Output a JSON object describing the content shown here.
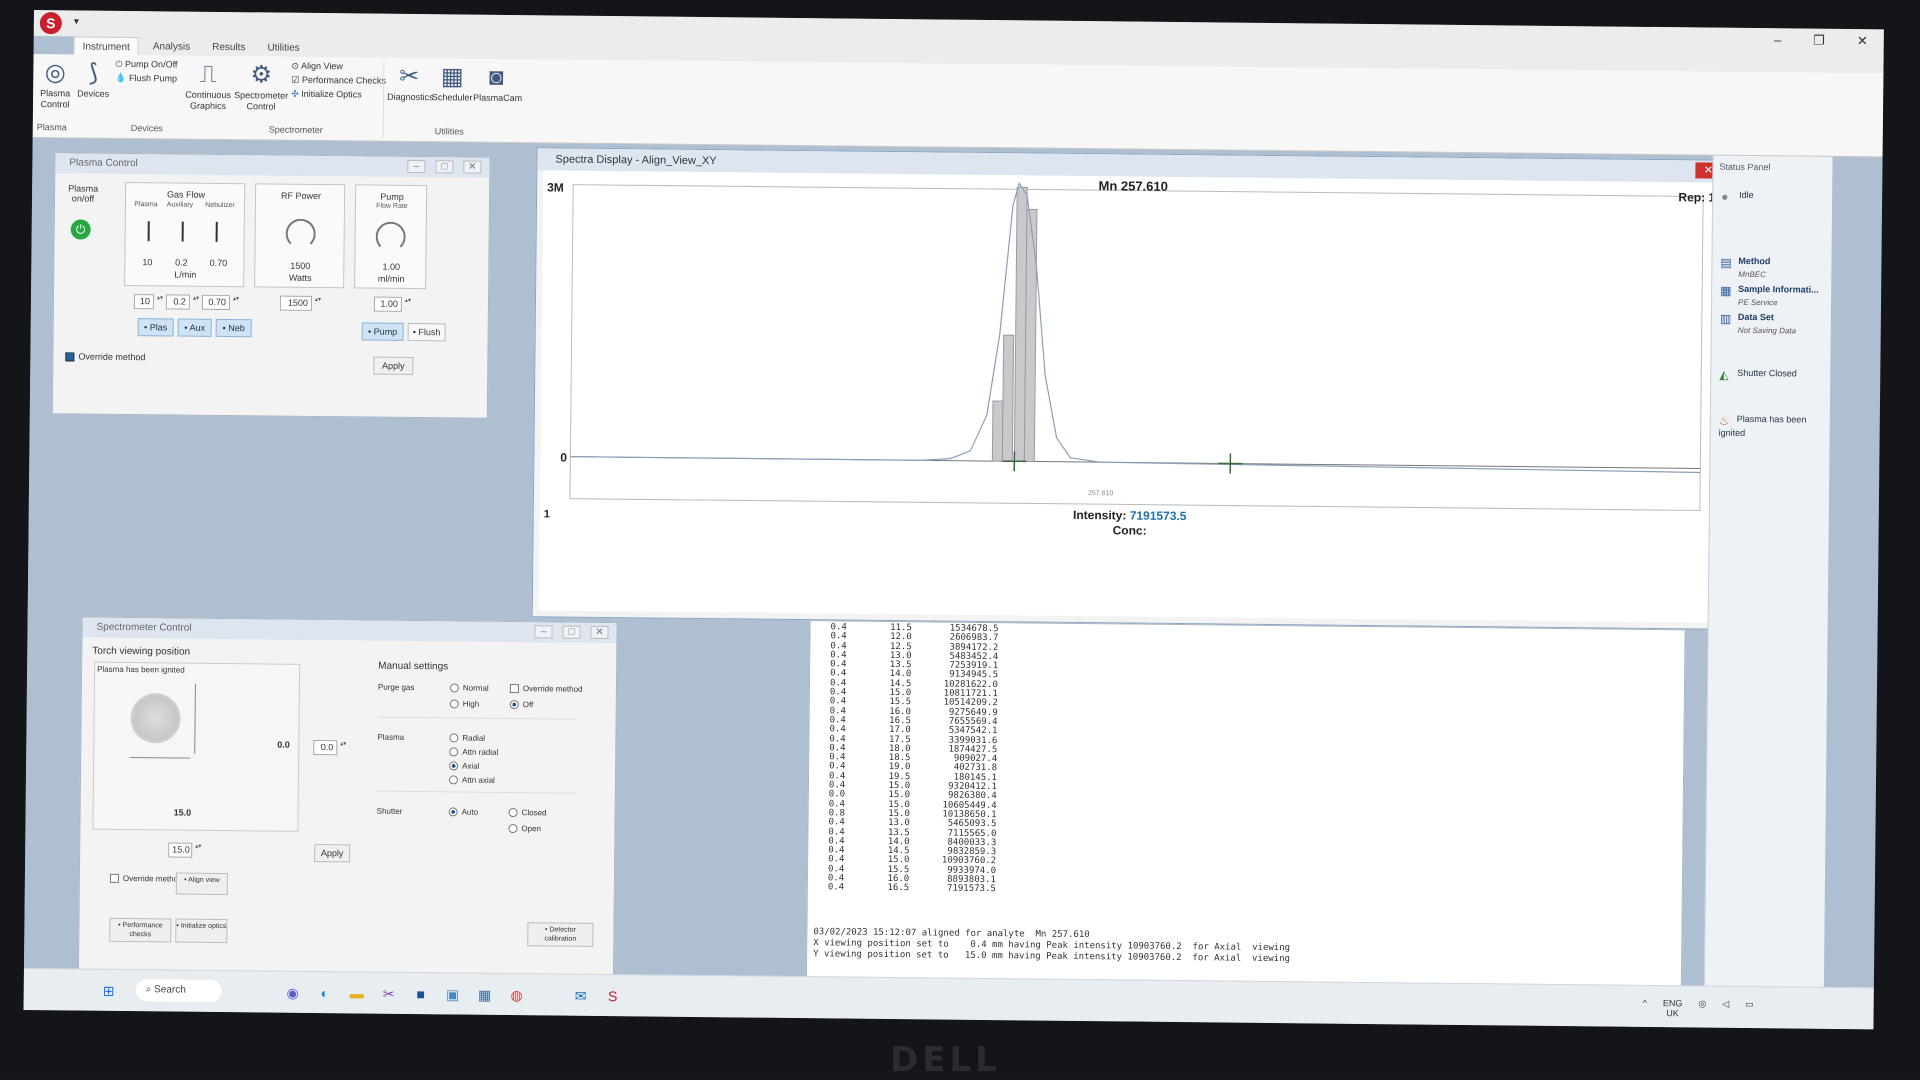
{
  "menu": {
    "tabs": [
      "Instrument",
      "Analysis",
      "Results",
      "Utilities"
    ]
  },
  "ribbon": {
    "plasma_control": "Plasma Control",
    "devices": "Devices",
    "pump_on_off": "Pump On/Off",
    "flush_pump": "Flush Pump",
    "continuous_graphics": "Continuous Graphics",
    "spectrometer_control": "Spectrometer Control",
    "align_view": "Align View",
    "performance_checks": "Performance Checks",
    "initialize_optics": "Initialize Optics",
    "diagnostics": "Diagnostics",
    "scheduler": "Scheduler",
    "plasmacam": "PlasmaCam",
    "groups": {
      "plasma": "Plasma",
      "devices": "Devices",
      "spectrometer": "Spectrometer",
      "utilities": "Utilities"
    }
  },
  "plasma_control": {
    "title": "Plasma Control",
    "plasma_on_off": "Plasma on/off",
    "gas_flow": "Gas Flow",
    "gas_cols": [
      "Plasma",
      "Auxiliary",
      "Nebulizer"
    ],
    "gas_values": [
      "10",
      "0.2",
      "0.70"
    ],
    "gas_unit": "L/min",
    "gas_inputs": [
      "10",
      "0.2",
      "0.70"
    ],
    "rf_power": "RF Power",
    "rf_value": "1500",
    "rf_unit": "Watts",
    "rf_input": "1500",
    "pump": "Pump",
    "pump_sub": "Flow Rate",
    "pump_value": "1.00",
    "pump_unit": "ml/min",
    "pump_input": "1.00",
    "btn_plas": "Plas",
    "btn_aux": "Aux",
    "btn_neb": "Neb",
    "btn_pump": "Pump",
    "btn_flush": "Flush",
    "override": "Override method",
    "apply": "Apply"
  },
  "spectra": {
    "title": "Spectra Display - Align_View_XY",
    "header": "Mn 257.610",
    "rep": "Rep: 1",
    "y_max_label": "3M",
    "y_zero_label": "0",
    "corner_label": "1",
    "center_tick": "257.610",
    "intensity_label": "Intensity:",
    "intensity_value": "7191573.5",
    "conc_label": "Conc:"
  },
  "spectrometer_control": {
    "title": "Spectrometer Control",
    "torch_title": "Torch viewing position",
    "torch_status": "Plasma has been ignited",
    "x_val": "0.0",
    "x_input": "0.0",
    "y_val": "15.0",
    "y_input": "15.0",
    "apply": "Apply",
    "override": "Override method",
    "align_view": "Align view",
    "performance_checks": "Performance checks",
    "initialize_optics": "Initialize optics",
    "detector_calibration": "Detector calibration",
    "manual_settings": "Manual settings",
    "purge_gas": "Purge gas",
    "normal": "Normal",
    "high": "High",
    "override_method": "Override method",
    "off": "Off",
    "plasma": "Plasma",
    "radial": "Radial",
    "attn_radial": "Attn radial",
    "axial": "Axial",
    "attn_axial": "Attn axial",
    "shutter": "Shutter",
    "auto": "Auto",
    "closed": "Closed",
    "open": "Open"
  },
  "results": {
    "lines": [
      "0.4        11.5       1534678.5",
      "0.4        12.0       2606983.7",
      "0.4        12.5       3894172.2",
      "0.4        13.0       5483452.4",
      "0.4        13.5       7253919.1",
      "0.4        14.0       9134945.5",
      "0.4        14.5      10281622.0",
      "0.4        15.0      10811721.1",
      "0.4        15.5      10514209.2",
      "0.4        16.0       9275649.9",
      "0.4        16.5       7655569.4",
      "0.4        17.0       5347542.1",
      "0.4        17.5       3399031.6",
      "0.4        18.0       1874427.5",
      "0.4        18.5        909027.4",
      "0.4        19.0        402731.8",
      "0.4        19.5        180145.1",
      "0.4        15.0       9320412.1",
      "0.0        15.0       9826380.4",
      "0.4        15.0      10605449.4",
      "0.8        15.0      10138650.1",
      "0.4        13.0       5465093.5",
      "0.4        13.5       7115565.0",
      "0.4        14.0       8400033.3",
      "0.4        14.5       9832859.3",
      "0.4        15.0      10903760.2",
      "0.4        15.5       9933974.0",
      "0.4        16.0       8893803.1",
      "0.4        16.5       7191573.5"
    ],
    "log": [
      "03/02/2023 15:12:07 aligned for analyte  Mn 257.610",
      "X viewing position set to    0.4 mm having Peak intensity 10903760.2  for Axial  viewing",
      "Y viewing position set to   15.0 mm having Peak intensity 10903760.2  for Axial  viewing"
    ]
  },
  "status_panel": {
    "title": "Status Panel",
    "state": "Idle",
    "method_label": "Method",
    "method_value": "MnBEC",
    "sample_label": "Sample Informati...",
    "sample_value": "PE Service",
    "dataset_label": "Data Set",
    "dataset_value": "Not Saving Data",
    "shutter": "Shutter Closed",
    "plasma": "Plasma has been ignited"
  },
  "taskbar": {
    "search": "Search",
    "lang": "ENG",
    "region": "UK"
  }
}
